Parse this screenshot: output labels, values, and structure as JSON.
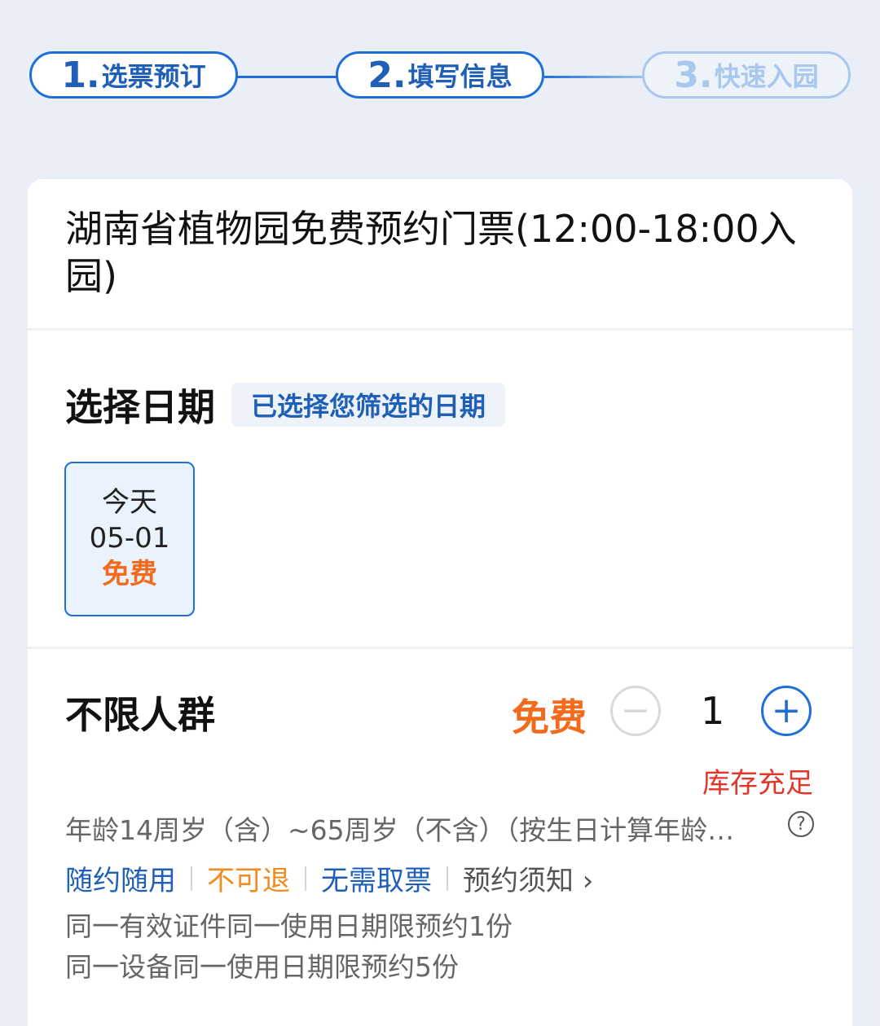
{
  "steps": [
    {
      "num": "1.",
      "label": "选票预订"
    },
    {
      "num": "2.",
      "label": "填写信息"
    },
    {
      "num": "3.",
      "label": "快速入园"
    }
  ],
  "ticket_title": "湖南省植物园免费预约门票(12:00-18:00入园)",
  "date_section": {
    "title": "选择日期",
    "tag": "已选择您筛选的日期",
    "selected_date": {
      "day": "今天",
      "date": "05-01",
      "price": "免费"
    }
  },
  "ticket": {
    "name": "不限人群",
    "price": "免费",
    "minus": "−",
    "plus": "+",
    "quantity": "1",
    "stock": "库存充足",
    "description": "年龄14周岁（含）~65周岁（不含）（按生日计算年龄…",
    "help": "?",
    "tags": [
      "随约随用",
      "不可退",
      "无需取票",
      "预约须知 ›"
    ],
    "rules": [
      "同一有效证件同一使用日期限预约1份",
      "同一设备同一使用日期限预约5份"
    ]
  }
}
